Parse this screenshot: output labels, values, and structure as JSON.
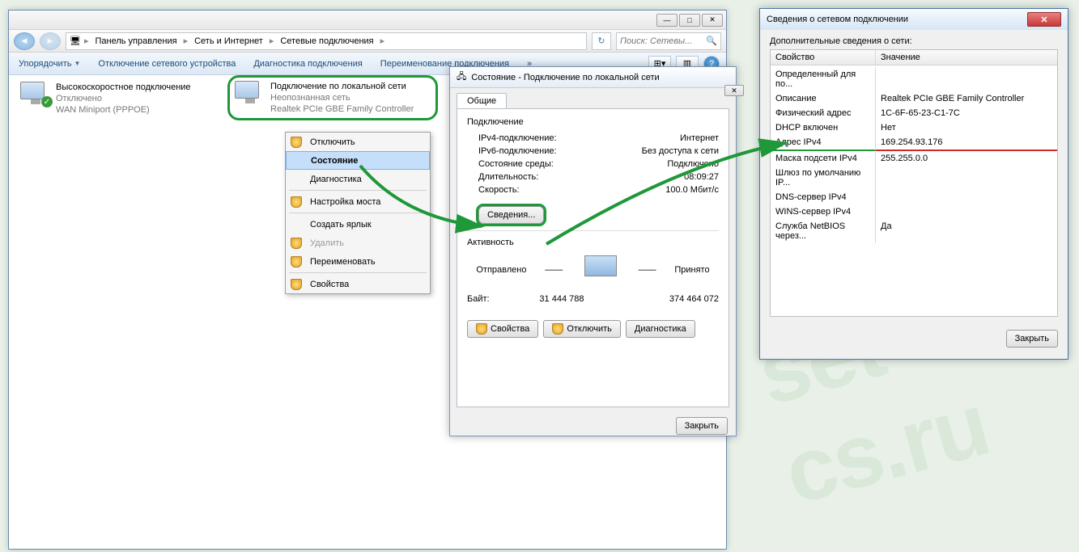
{
  "breadcrumb": {
    "item1": "Панель управления",
    "item2": "Сеть и Интернет",
    "item3": "Сетевые подключения"
  },
  "search": {
    "placeholder": "Поиск: Сетевы..."
  },
  "toolbar": {
    "organize": "Упорядочить",
    "disable_device": "Отключение сетевого устройства",
    "diagnose": "Диагностика подключения",
    "rename": "Переименование подключения"
  },
  "connections": {
    "c1": {
      "title": "Высокоскоростное подключение",
      "sub1": "Отключено",
      "sub2": "WAN Miniport (PPPOE)"
    },
    "c2": {
      "title": "Подключение по локальной сети",
      "sub1": "Неопознанная сеть",
      "sub2": "Realtek PCIe GBE Family Controller"
    }
  },
  "ctx": {
    "disable": "Отключить",
    "status": "Состояние",
    "diagnose": "Диагностика",
    "bridge": "Настройка моста",
    "shortcut": "Создать ярлык",
    "delete": "Удалить",
    "rename": "Переименовать",
    "props": "Свойства"
  },
  "status_dialog": {
    "title": "Состояние - Подключение по локальной сети",
    "tab": "Общие",
    "section_conn": "Подключение",
    "ipv4_label": "IPv4-подключение:",
    "ipv4_val": "Интернет",
    "ipv6_label": "IPv6-подключение:",
    "ipv6_val": "Без доступа к сети",
    "media_label": "Состояние среды:",
    "media_val": "Подключено",
    "dur_label": "Длительность:",
    "dur_val": "08:09:27",
    "speed_label": "Скорость:",
    "speed_val": "100.0 Мбит/с",
    "details_btn": "Сведения...",
    "section_act": "Активность",
    "sent_label": "Отправлено",
    "recv_label": "Принято",
    "bytes_label": "Байт:",
    "bytes_sent": "31 444 788",
    "bytes_recv": "374 464 072",
    "btn_props": "Свойства",
    "btn_disable": "Отключить",
    "btn_diag": "Диагностика",
    "close": "Закрыть"
  },
  "details_dialog": {
    "title": "Сведения о сетевом подключении",
    "label": "Дополнительные сведения о сети:",
    "col_prop": "Свойство",
    "col_val": "Значение",
    "rows": [
      {
        "k": "Определенный для по...",
        "v": ""
      },
      {
        "k": "Описание",
        "v": "Realtek PCIe GBE Family Controller"
      },
      {
        "k": "Физический адрес",
        "v": "1C-6F-65-23-C1-7C"
      },
      {
        "k": "DHCP включен",
        "v": "Нет"
      },
      {
        "k": "Адрес IPv4",
        "v": "169.254.93.176"
      },
      {
        "k": "Маска подсети IPv4",
        "v": "255.255.0.0"
      },
      {
        "k": "Шлюз по умолчанию IP...",
        "v": ""
      },
      {
        "k": "DNS-сервер IPv4",
        "v": ""
      },
      {
        "k": "WINS-сервер IPv4",
        "v": ""
      },
      {
        "k": "Служба NetBIOS через...",
        "v": "Да"
      }
    ],
    "close": "Закрыть"
  }
}
